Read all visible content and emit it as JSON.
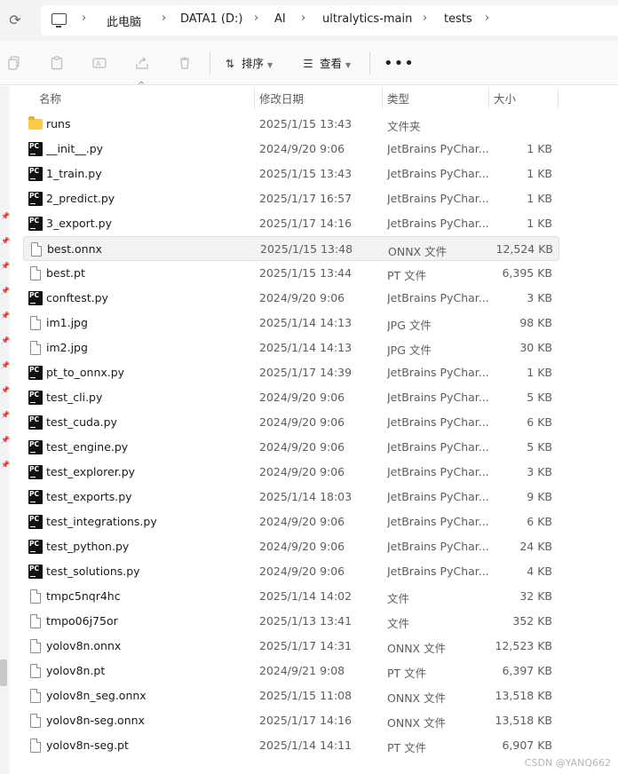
{
  "address": {
    "breadcrumbs": [
      "此电脑",
      "DATA1 (D:)",
      "AI",
      "ultralytics-main",
      "tests"
    ]
  },
  "toolbar": {
    "sort_label": "排序",
    "view_label": "查看",
    "more_label": "•••"
  },
  "columns": {
    "name": "名称",
    "date": "修改日期",
    "type": "类型",
    "size": "大小"
  },
  "files": [
    {
      "name": "runs",
      "date": "2025/1/15 13:43",
      "type": "文件夹",
      "size": "",
      "icon": "folder-icon"
    },
    {
      "name": "__init__.py",
      "date": "2024/9/20 9:06",
      "type": "JetBrains PyChar...",
      "size": "1 KB",
      "icon": "pycharm-file-icon"
    },
    {
      "name": "1_train.py",
      "date": "2025/1/15 13:43",
      "type": "JetBrains PyChar...",
      "size": "1 KB",
      "icon": "pycharm-file-icon"
    },
    {
      "name": "2_predict.py",
      "date": "2025/1/17 16:57",
      "type": "JetBrains PyChar...",
      "size": "1 KB",
      "icon": "pycharm-file-icon"
    },
    {
      "name": "3_export.py",
      "date": "2025/1/17 14:16",
      "type": "JetBrains PyChar...",
      "size": "1 KB",
      "icon": "pycharm-file-icon"
    },
    {
      "name": "best.onnx",
      "date": "2025/1/15 13:48",
      "type": "ONNX 文件",
      "size": "12,524 KB",
      "icon": "document-icon",
      "selected": true
    },
    {
      "name": "best.pt",
      "date": "2025/1/15 13:44",
      "type": "PT 文件",
      "size": "6,395 KB",
      "icon": "document-icon"
    },
    {
      "name": "conftest.py",
      "date": "2024/9/20 9:06",
      "type": "JetBrains PyChar...",
      "size": "3 KB",
      "icon": "pycharm-file-icon"
    },
    {
      "name": "im1.jpg",
      "date": "2025/1/14 14:13",
      "type": "JPG 文件",
      "size": "98 KB",
      "icon": "document-icon"
    },
    {
      "name": "im2.jpg",
      "date": "2025/1/14 14:13",
      "type": "JPG 文件",
      "size": "30 KB",
      "icon": "document-icon"
    },
    {
      "name": "pt_to_onnx.py",
      "date": "2025/1/17 14:39",
      "type": "JetBrains PyChar...",
      "size": "1 KB",
      "icon": "pycharm-file-icon"
    },
    {
      "name": "test_cli.py",
      "date": "2024/9/20 9:06",
      "type": "JetBrains PyChar...",
      "size": "5 KB",
      "icon": "pycharm-file-icon"
    },
    {
      "name": "test_cuda.py",
      "date": "2024/9/20 9:06",
      "type": "JetBrains PyChar...",
      "size": "6 KB",
      "icon": "pycharm-file-icon"
    },
    {
      "name": "test_engine.py",
      "date": "2024/9/20 9:06",
      "type": "JetBrains PyChar...",
      "size": "5 KB",
      "icon": "pycharm-file-icon"
    },
    {
      "name": "test_explorer.py",
      "date": "2024/9/20 9:06",
      "type": "JetBrains PyChar...",
      "size": "3 KB",
      "icon": "pycharm-file-icon"
    },
    {
      "name": "test_exports.py",
      "date": "2025/1/14 18:03",
      "type": "JetBrains PyChar...",
      "size": "9 KB",
      "icon": "pycharm-file-icon"
    },
    {
      "name": "test_integrations.py",
      "date": "2024/9/20 9:06",
      "type": "JetBrains PyChar...",
      "size": "6 KB",
      "icon": "pycharm-file-icon"
    },
    {
      "name": "test_python.py",
      "date": "2024/9/20 9:06",
      "type": "JetBrains PyChar...",
      "size": "24 KB",
      "icon": "pycharm-file-icon"
    },
    {
      "name": "test_solutions.py",
      "date": "2024/9/20 9:06",
      "type": "JetBrains PyChar...",
      "size": "4 KB",
      "icon": "pycharm-file-icon"
    },
    {
      "name": "tmpc5nqr4hc",
      "date": "2025/1/14 14:02",
      "type": "文件",
      "size": "32 KB",
      "icon": "document-icon"
    },
    {
      "name": "tmpo06j75or",
      "date": "2025/1/13 13:41",
      "type": "文件",
      "size": "352 KB",
      "icon": "document-icon"
    },
    {
      "name": "yolov8n.onnx",
      "date": "2025/1/17 14:31",
      "type": "ONNX 文件",
      "size": "12,523 KB",
      "icon": "document-icon"
    },
    {
      "name": "yolov8n.pt",
      "date": "2024/9/21 9:08",
      "type": "PT 文件",
      "size": "6,397 KB",
      "icon": "document-icon"
    },
    {
      "name": "yolov8n_seg.onnx",
      "date": "2025/1/15 11:08",
      "type": "ONNX 文件",
      "size": "13,518 KB",
      "icon": "document-icon"
    },
    {
      "name": "yolov8n-seg.onnx",
      "date": "2025/1/17 14:16",
      "type": "ONNX 文件",
      "size": "13,518 KB",
      "icon": "document-icon"
    },
    {
      "name": "yolov8n-seg.pt",
      "date": "2025/1/14 14:11",
      "type": "PT 文件",
      "size": "6,907 KB",
      "icon": "document-icon"
    }
  ],
  "watermark": "CSDN @YANQ662",
  "colors": {
    "folder": "#f8c94b",
    "pycharm_icon": "#111111",
    "selected_row": "#f2f2f2"
  }
}
